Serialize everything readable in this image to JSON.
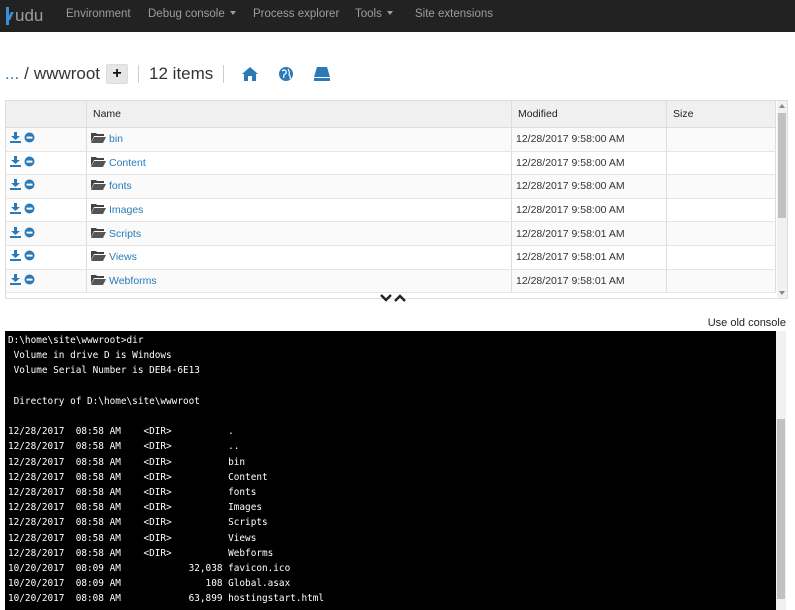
{
  "navbar": {
    "brand": "udu",
    "items": [
      {
        "label": "Environment",
        "dropdown": false
      },
      {
        "label": "Debug console",
        "dropdown": true
      },
      {
        "label": "Process explorer",
        "dropdown": false
      },
      {
        "label": "Tools",
        "dropdown": true
      },
      {
        "label": "Site extensions",
        "dropdown": false
      }
    ]
  },
  "toolbar": {
    "ellipsis": "...",
    "slash": "/",
    "folder": "wwwroot",
    "add_label": "+",
    "item_count": "12 items",
    "icons": [
      "home-icon",
      "globe-icon",
      "drive-icon"
    ]
  },
  "file_table": {
    "headers": [
      "Name",
      "Modified",
      "Size"
    ],
    "rows": [
      {
        "name": "bin",
        "modified": "12/28/2017 9:58:00 AM",
        "size": ""
      },
      {
        "name": "Content",
        "modified": "12/28/2017 9:58:00 AM",
        "size": ""
      },
      {
        "name": "fonts",
        "modified": "12/28/2017 9:58:00 AM",
        "size": ""
      },
      {
        "name": "Images",
        "modified": "12/28/2017 9:58:00 AM",
        "size": ""
      },
      {
        "name": "Scripts",
        "modified": "12/28/2017 9:58:01 AM",
        "size": ""
      },
      {
        "name": "Views",
        "modified": "12/28/2017 9:58:01 AM",
        "size": ""
      },
      {
        "name": "Webforms",
        "modified": "12/28/2017 9:58:01 AM",
        "size": ""
      }
    ]
  },
  "console": {
    "old_console_link": "Use old console",
    "lines": [
      "D:\\home\\site\\wwwroot>dir",
      " Volume in drive D is Windows",
      " Volume Serial Number is DEB4-6E13",
      "",
      " Directory of D:\\home\\site\\wwwroot",
      "",
      "12/28/2017  08:58 AM    <DIR>          .",
      "12/28/2017  08:58 AM    <DIR>          ..",
      "12/28/2017  08:58 AM    <DIR>          bin",
      "12/28/2017  08:58 AM    <DIR>          Content",
      "12/28/2017  08:58 AM    <DIR>          fonts",
      "12/28/2017  08:58 AM    <DIR>          Images",
      "12/28/2017  08:58 AM    <DIR>          Scripts",
      "12/28/2017  08:58 AM    <DIR>          Views",
      "12/28/2017  08:58 AM    <DIR>          Webforms",
      "10/20/2017  08:09 AM            32,038 favicon.ico",
      "10/20/2017  08:09 AM               108 Global.asax",
      "10/20/2017  08:08 AM            63,899 hostingstart.html"
    ]
  },
  "colors": {
    "navbar_bg": "#222222",
    "link": "#2a7ab8",
    "accent_blue": "#3a8fd8",
    "console_bg": "#000000"
  }
}
